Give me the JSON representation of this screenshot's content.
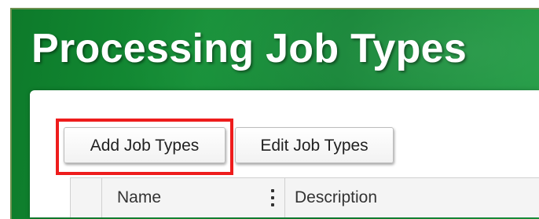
{
  "header": {
    "title": "Processing Job Types",
    "background_color": "#159037",
    "title_color": "#ffffff"
  },
  "toolbar": {
    "add_label": "Add Job Types",
    "edit_label": "Edit Job Types",
    "highlight_color": "#ee1c1c"
  },
  "grid": {
    "columns": [
      {
        "label": ""
      },
      {
        "label": "Name",
        "menu_icon": "kebab-menu-icon"
      },
      {
        "label": "Description"
      }
    ]
  }
}
